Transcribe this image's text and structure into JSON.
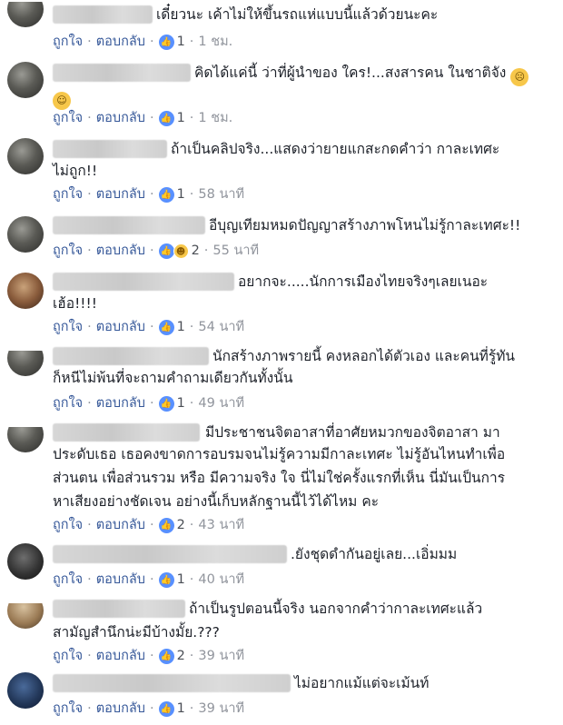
{
  "actions": {
    "like": "ถูกใจ",
    "reply": "ตอบกลับ"
  },
  "icons": {
    "like": "thumbs-up-icon",
    "haha": "haha-icon",
    "emoji": "face-emoji-icon"
  },
  "colors": {
    "link": "#365899",
    "like_badge": "#5890ff",
    "meta": "#90949c"
  },
  "comments": [
    {
      "lines": [
        "เดี๋ยวนะ เค้าไม่ให้ขึ้นรถแห่แบบนี้แล้วด้วยนะคะ"
      ],
      "reactions": "1",
      "time": "1 ชม."
    },
    {
      "lines": [
        "คิดได้แค่นี้ ว่าที่ผู้นำของ ใคร!...สงสารคน ในชาติจัง"
      ],
      "reactions": "1",
      "time": "1 ชม."
    },
    {
      "lines": [
        "ถ้าเป็นคลิปจริง...แสดงว่ายายแกสะกดคำว่า กาละเทศะ",
        "ไม่ถูก!!"
      ],
      "reactions": "1",
      "time": "58 นาที"
    },
    {
      "lines": [
        "อีบุญเทียมหมดปัญญาสร้างภาพโหนไม่รู้กาละเทศะ!!"
      ],
      "reactions": "2",
      "time": "55 นาที"
    },
    {
      "lines": [
        "อยากจะ.....นักการเมืองไทยจริงๆเลยเนอะ",
        "เฮ้อ!!!!"
      ],
      "reactions": "1",
      "time": "54 นาที"
    },
    {
      "lines": [
        "นักสร้างภาพรายนี้ คงหลอกได้ตัวเอง และคนที่รู้ทัน",
        "ก็หนีไม่พ้นที่จะถามคำถามเดียวกันทั้งนั้น"
      ],
      "reactions": "1",
      "time": "49 นาที"
    },
    {
      "lines": [
        "มีประชาชนจิตอาสาที่อาศัยหมวกของจิตอาสา มา",
        "ประดับเธอ เธอคงขาดการอบรมจนไม่รู้ความมีกาละเทศะ ไม่รู้อันไหนทำเพื่อ",
        "ส่วนตน เพื่อส่วนรวม หรือ มีความจริง ใจ นี่ไม่ใช่ครั้งแรกที่เห็น นี่มันเป็นการ",
        "หาเสียงอย่างชัดเจน อย่างนี้เก็บหลักฐานนี้ไว้ได้ไหม คะ"
      ],
      "reactions": "2",
      "time": "43 นาที"
    },
    {
      "lines": [
        ".ยังชุดดำกันอยู่เลย...เอิ่มมม"
      ],
      "reactions": "1",
      "time": "40 นาที"
    },
    {
      "lines": [
        "ถ้าเป็นรูปตอนนี้จริง นอกจากคำว่ากาละเทศะแล้ว",
        "สามัญสำนึกน่ะมีบ้างมั้ย.???"
      ],
      "reactions": "2",
      "time": "39 นาที"
    },
    {
      "lines": [
        "ไม่อยากแม้แต่จะเม้นท์"
      ],
      "reactions": "1",
      "time": "39 นาที"
    }
  ]
}
